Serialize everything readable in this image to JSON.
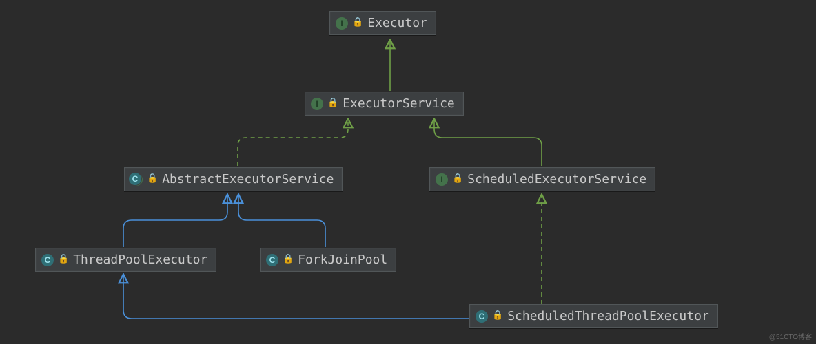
{
  "watermark": "@51CTO博客",
  "nodes": {
    "executor": {
      "name": "Executor",
      "icon": "I",
      "iconKind": "interface"
    },
    "executorService": {
      "name": "ExecutorService",
      "icon": "I",
      "iconKind": "interface"
    },
    "abstractExecutorService": {
      "name": "AbstractExecutorService",
      "icon": "C",
      "iconKind": "abstract-class"
    },
    "scheduledExecutorService": {
      "name": "ScheduledExecutorService",
      "icon": "I",
      "iconKind": "interface"
    },
    "threadPoolExecutor": {
      "name": "ThreadPoolExecutor",
      "icon": "C",
      "iconKind": "class"
    },
    "forkJoinPool": {
      "name": "ForkJoinPool",
      "icon": "C",
      "iconKind": "class"
    },
    "scheduledThreadPoolExecutor": {
      "name": "ScheduledThreadPoolExecutor",
      "icon": "C",
      "iconKind": "class"
    }
  },
  "edges": [
    {
      "from": "executorService",
      "to": "executor",
      "style": "solid",
      "color": "green",
      "kind": "implements/extends"
    },
    {
      "from": "abstractExecutorService",
      "to": "executorService",
      "style": "dashed",
      "color": "green",
      "kind": "implements"
    },
    {
      "from": "scheduledExecutorService",
      "to": "executorService",
      "style": "solid",
      "color": "green",
      "kind": "extends"
    },
    {
      "from": "threadPoolExecutor",
      "to": "abstractExecutorService",
      "style": "solid",
      "color": "blue",
      "kind": "extends"
    },
    {
      "from": "forkJoinPool",
      "to": "abstractExecutorService",
      "style": "solid",
      "color": "blue",
      "kind": "extends"
    },
    {
      "from": "scheduledThreadPoolExecutor",
      "to": "threadPoolExecutor",
      "style": "solid",
      "color": "blue",
      "kind": "extends"
    },
    {
      "from": "scheduledThreadPoolExecutor",
      "to": "scheduledExecutorService",
      "style": "dashed",
      "color": "green",
      "kind": "implements"
    }
  ],
  "colors": {
    "green": "#6f9f47",
    "blue": "#4a90d9"
  }
}
